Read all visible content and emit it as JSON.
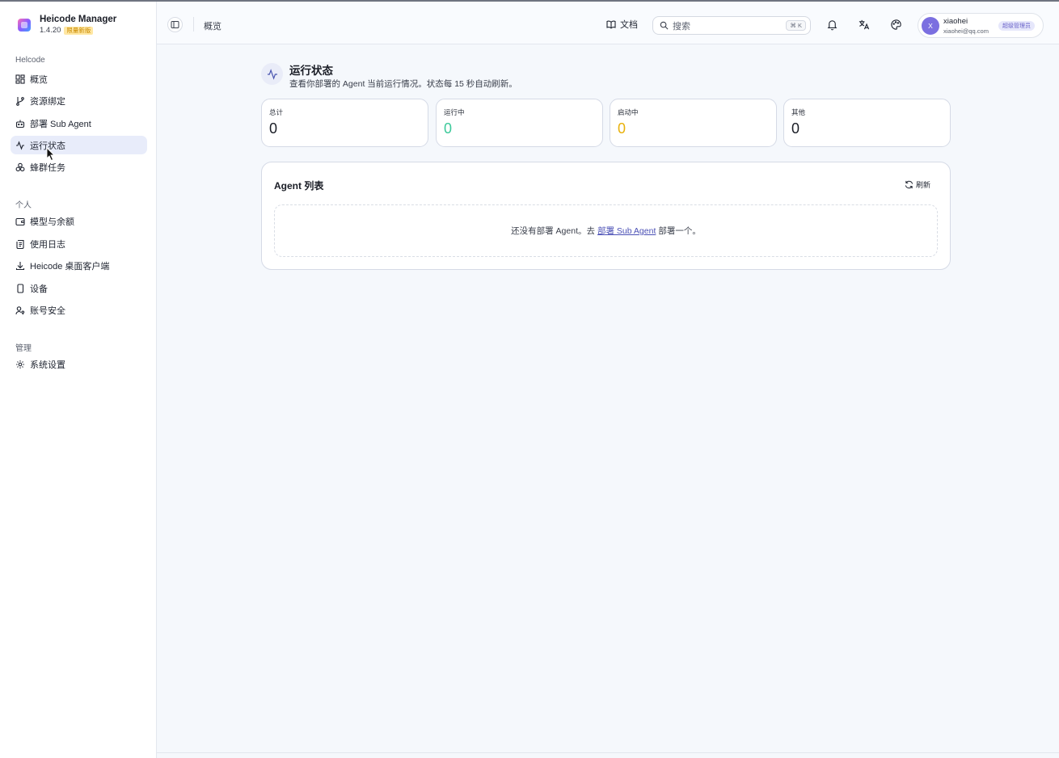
{
  "brand": {
    "name": "Heicode Manager",
    "version": "1.4.20",
    "badge": "限量新版"
  },
  "sidebar": {
    "section1": "Helcode",
    "items1": [
      {
        "label": "概览",
        "icon": "dashboard-icon"
      },
      {
        "label": "资源绑定",
        "icon": "git-branch-icon"
      },
      {
        "label": "部署 Sub Agent",
        "icon": "bot-icon"
      },
      {
        "label": "运行状态",
        "icon": "activity-icon",
        "active": true
      },
      {
        "label": "蜂群任务",
        "icon": "boxes-icon"
      }
    ],
    "section2": "个人",
    "items2": [
      {
        "label": "模型与余额",
        "icon": "wallet-icon"
      },
      {
        "label": "使用日志",
        "icon": "scroll-icon"
      },
      {
        "label": "Heicode 桌面客户端",
        "icon": "download-icon"
      },
      {
        "label": "设备",
        "icon": "smartphone-icon"
      },
      {
        "label": "账号安全",
        "icon": "user-key-icon"
      }
    ],
    "section3": "管理",
    "items3": [
      {
        "label": "系统设置",
        "icon": "settings-icon"
      }
    ]
  },
  "topbar": {
    "breadcrumb": "概览",
    "docs_label": "文档",
    "search_placeholder": "搜索",
    "search_shortcut": "⌘ K"
  },
  "user": {
    "initial": "X",
    "name": "xiaohei",
    "email": "xiaohei@qq.com",
    "role": "超级管理员"
  },
  "page": {
    "title": "运行状态",
    "subtitle": "查看你部署的 Agent 当前运行情况。状态每 15 秒自动刷新。"
  },
  "stats": [
    {
      "label": "总计",
      "value": "0",
      "color": "#1a1d26"
    },
    {
      "label": "运行中",
      "value": "0",
      "color": "#3cc99a"
    },
    {
      "label": "启动中",
      "value": "0",
      "color": "#e8b10c"
    },
    {
      "label": "其他",
      "value": "0",
      "color": "#1a1d26"
    }
  ],
  "agent_list": {
    "title": "Agent 列表",
    "refresh_label": "刷新",
    "empty_prefix": "还没有部署 Agent。去",
    "empty_link": "部署 Sub Agent",
    "empty_suffix": "部署一个。"
  }
}
